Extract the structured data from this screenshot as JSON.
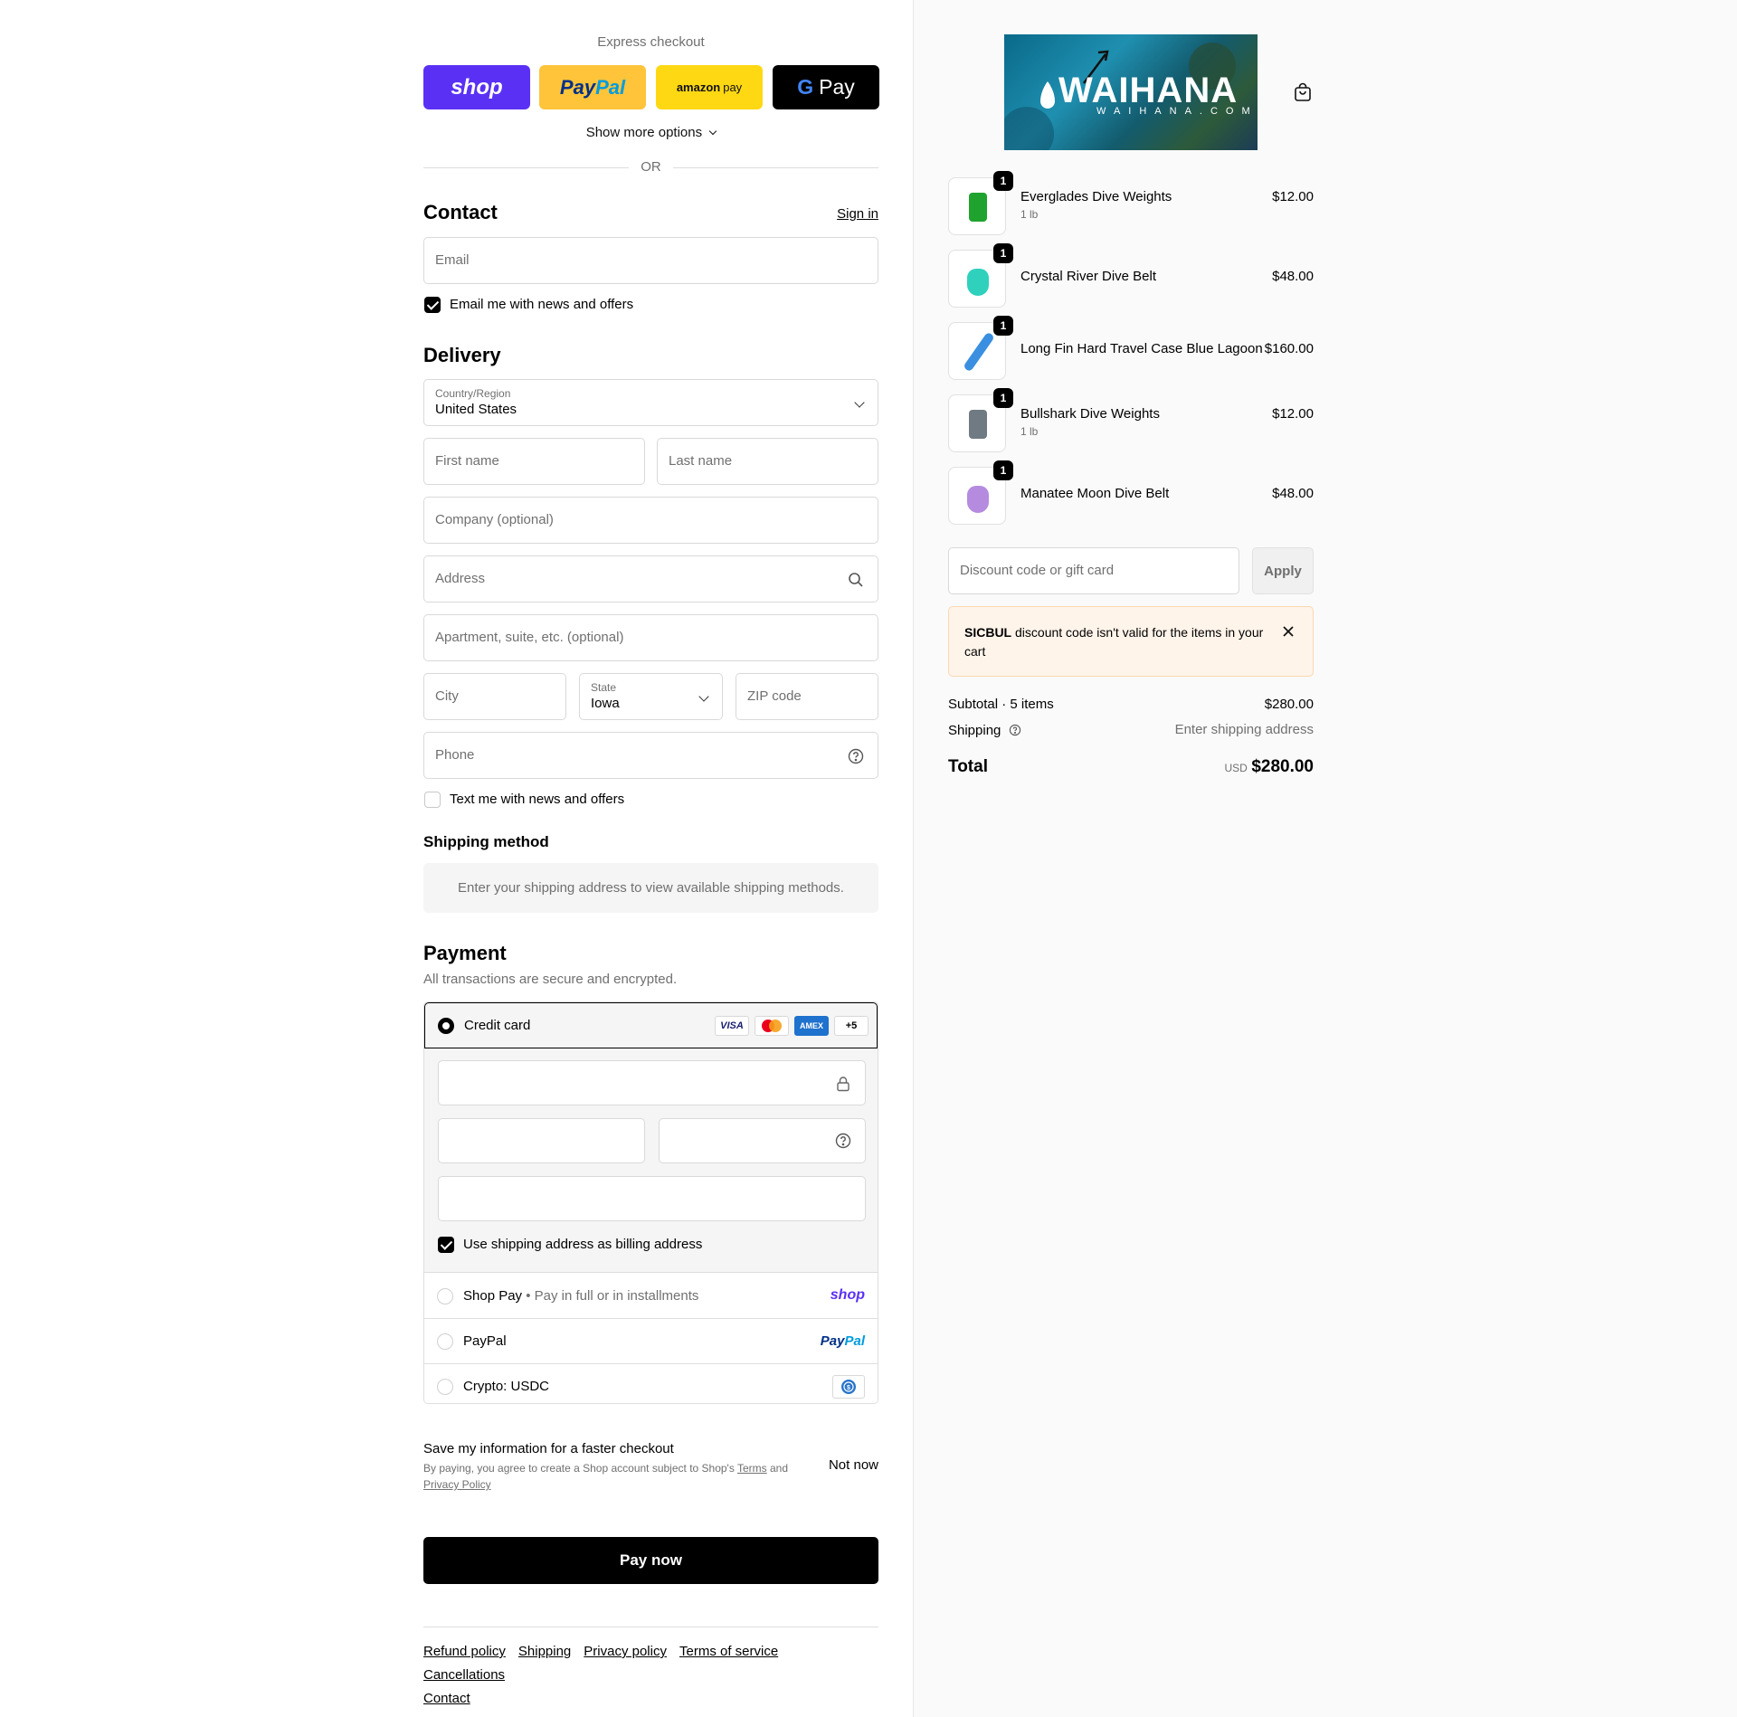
{
  "express": {
    "title": "Express checkout",
    "shop_label": "shop",
    "paypal_part1": "Pay",
    "paypal_part2": "Pal",
    "amazon_part1": "amazon",
    "amazon_part2": "pay",
    "gpay_g": "G",
    "gpay_label": "Pay",
    "show_more": "Show more options",
    "or": "OR"
  },
  "contact": {
    "title": "Contact",
    "sign_in": "Sign in",
    "email_placeholder": "Email",
    "news_label": "Email me with news and offers",
    "news_checked": true
  },
  "delivery": {
    "title": "Delivery",
    "country_label": "Country/Region",
    "country_value": "United States",
    "first_name": "First name",
    "last_name": "Last name",
    "company": "Company (optional)",
    "address": "Address",
    "apartment": "Apartment, suite, etc. (optional)",
    "city": "City",
    "state_label": "State",
    "state_value": "Iowa",
    "zip": "ZIP code",
    "phone": "Phone",
    "text_label": "Text me with news and offers",
    "text_checked": false
  },
  "shipping_method": {
    "title": "Shipping method",
    "message": "Enter your shipping address to view available shipping methods."
  },
  "payment": {
    "title": "Payment",
    "subtitle": "All transactions are secure and encrypted.",
    "credit_card": "Credit card",
    "badges": {
      "visa": "VISA",
      "amex": "AMEX",
      "more": "+5"
    },
    "billing_label": "Use shipping address as billing address",
    "shop_pay": "Shop Pay",
    "shop_pay_sub": "Pay in full or in installments",
    "shop_pay_logo": "shop",
    "paypal": "PayPal",
    "paypal_logo1": "Pay",
    "paypal_logo2": "Pal",
    "crypto": "Crypto: USDC"
  },
  "save": {
    "title": "Save my information for a faster checkout",
    "sub_prefix": "By paying, you agree to create a Shop account subject to Shop's",
    "terms": "Terms",
    "and": "and",
    "privacy": "Privacy Policy",
    "not_now": "Not now"
  },
  "pay_now": "Pay now",
  "footer": {
    "refund": "Refund policy",
    "shipping": "Shipping",
    "privacy": "Privacy policy",
    "terms": "Terms of service",
    "cancellations": "Cancellations",
    "contact": "Contact"
  },
  "brand": {
    "name": "WAIHANA",
    "domain": "WAIHANA.COM"
  },
  "cart": {
    "items": [
      {
        "name": "Everglades Dive Weights",
        "variant": "1 lb",
        "price": "$12.00",
        "qty": "1",
        "color": "#1fa32e"
      },
      {
        "name": "Crystal River Dive Belt",
        "variant": "",
        "price": "$48.00",
        "qty": "1",
        "color": "#2fd1bd"
      },
      {
        "name": "Long Fin Hard Travel Case Blue Lagoon",
        "variant": "",
        "price": "$160.00",
        "qty": "1",
        "color": "#3a8fe0"
      },
      {
        "name": "Bullshark Dive Weights",
        "variant": "1 lb",
        "price": "$12.00",
        "qty": "1",
        "color": "#6f7a82"
      },
      {
        "name": "Manatee Moon Dive Belt",
        "variant": "",
        "price": "$48.00",
        "qty": "1",
        "color": "#b58be0"
      }
    ],
    "discount_placeholder": "Discount code or gift card",
    "apply": "Apply",
    "error_code": "SICBUL",
    "error_msg": "discount code isn't valid for the items in your cart",
    "subtotal_label": "Subtotal · 5 items",
    "subtotal_value": "$280.00",
    "shipping_label": "Shipping",
    "shipping_value": "Enter shipping address",
    "total_label": "Total",
    "currency": "USD",
    "total_value": "$280.00"
  }
}
